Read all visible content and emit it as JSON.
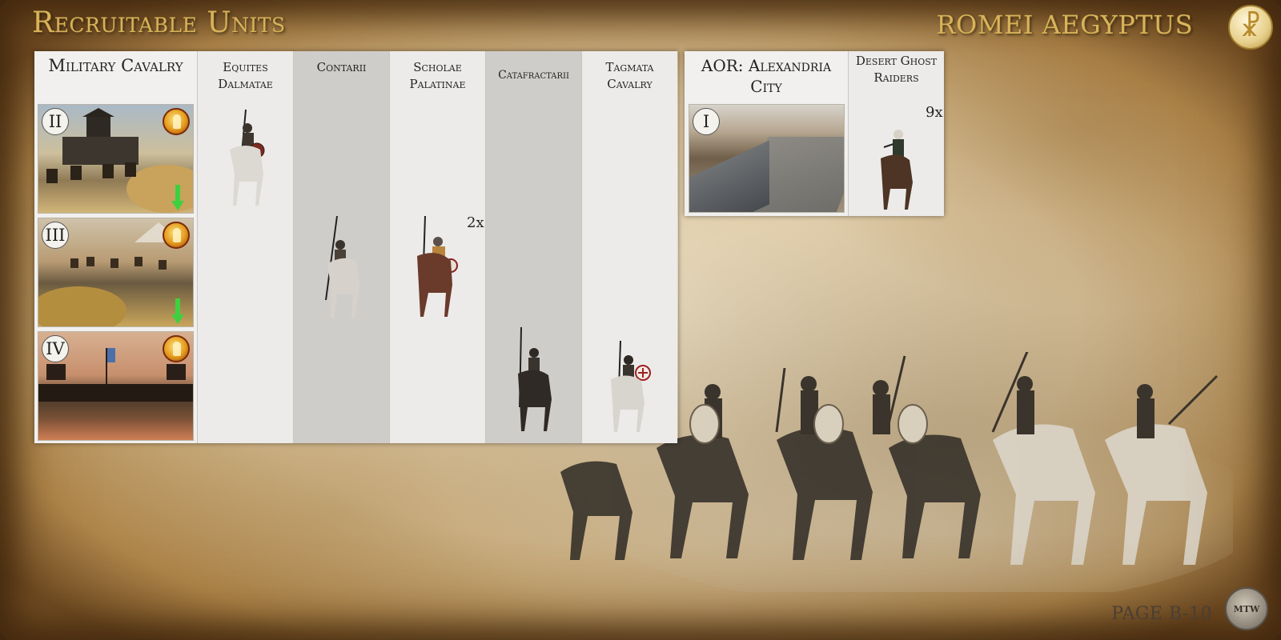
{
  "header": {
    "title": "Recruitable Units",
    "faction": "ROMEI AEGYPTUS",
    "faction_icon": "chi-rho-icon"
  },
  "building": {
    "name": "Military Cavalry",
    "tiers": [
      {
        "numeral": "II"
      },
      {
        "numeral": "III"
      },
      {
        "numeral": "IV"
      }
    ]
  },
  "units": [
    {
      "name": "Equites Dalmatae",
      "multiplier": ""
    },
    {
      "name": "Contarii",
      "multiplier": ""
    },
    {
      "name": "Scholae Palatinae",
      "multiplier": "2x"
    },
    {
      "name": "Catafractarii",
      "multiplier": ""
    },
    {
      "name": "Tagmata Cavalry",
      "multiplier": ""
    }
  ],
  "aor": {
    "title": "AOR: Alexandria City",
    "tier_numeral": "I",
    "unit": {
      "name": "Desert Ghost Raiders",
      "multiplier": "9x"
    }
  },
  "footer": {
    "page": "PAGE B-10"
  },
  "colors": {
    "title_gold": "#d8b35a",
    "upgrade_arrow": "#3fd03f"
  }
}
